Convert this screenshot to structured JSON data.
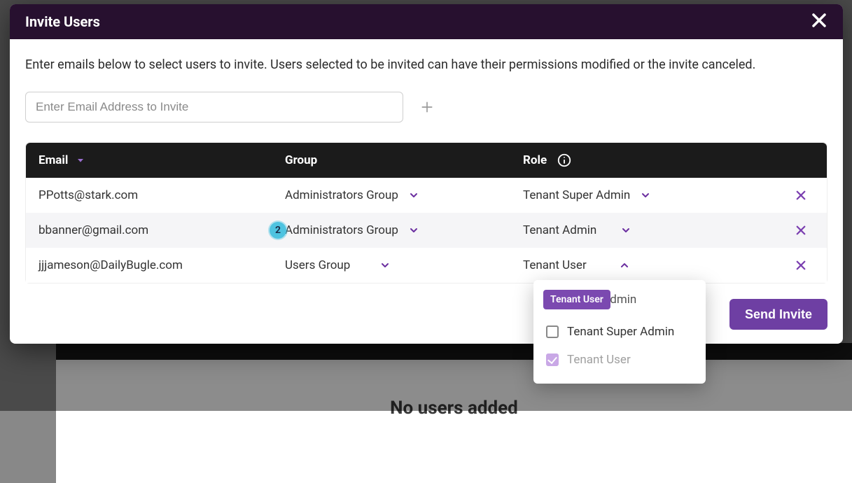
{
  "modal": {
    "title": "Invite Users",
    "intro": "Enter emails below to select users to invite. Users selected to be invited can have their permissions modified or the invite canceled.",
    "email_placeholder": "Enter Email Address to Invite",
    "send_label": "Send Invite"
  },
  "table": {
    "headers": {
      "email": "Email",
      "group": "Group",
      "role": "Role"
    },
    "rows": [
      {
        "email": "PPotts@stark.com",
        "group": "Administrators Group",
        "role": "Tenant Super Admin",
        "badge": null,
        "role_open": false
      },
      {
        "email": "bbanner@gmail.com",
        "group": "Administrators Group",
        "role": "Tenant Admin",
        "badge": "2",
        "role_open": false
      },
      {
        "email": "jjjameson@DailyBugle.com",
        "group": "Users Group",
        "role": "Tenant User",
        "badge": null,
        "role_open": true
      }
    ]
  },
  "role_dropdown": {
    "selected_chip": "Tenant User",
    "ghost_option": "Tenant Admin",
    "options": [
      {
        "label": "Tenant Super Admin",
        "checked": false,
        "disabled": false
      },
      {
        "label": "Tenant User",
        "checked": true,
        "disabled": true
      }
    ]
  },
  "background": {
    "empty_text": "No users added"
  }
}
